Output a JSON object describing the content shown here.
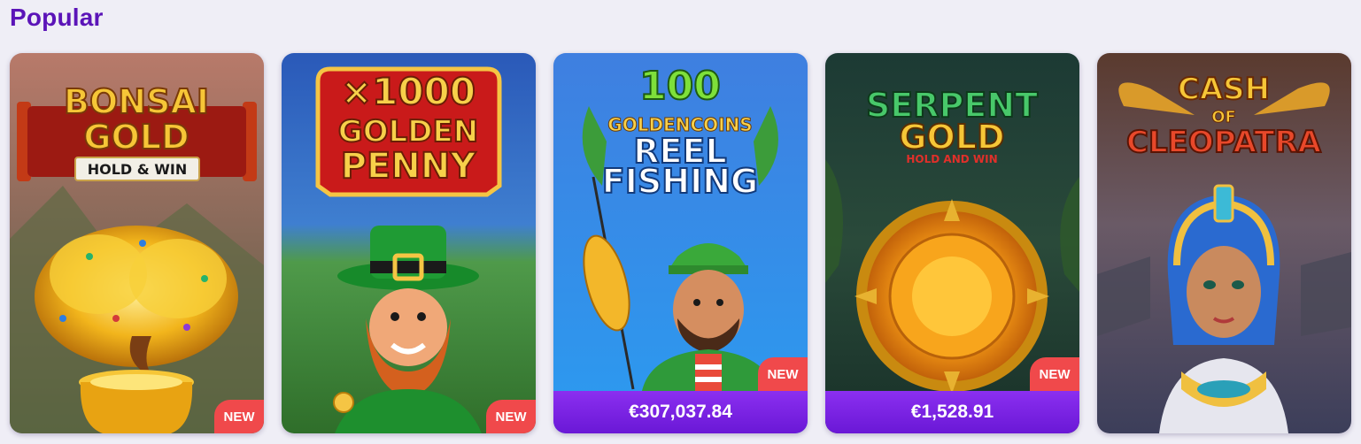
{
  "section": {
    "title": "Popular"
  },
  "games": [
    {
      "logo_lines": [
        "BONSAI",
        "GOLD",
        "HOLD & WIN"
      ],
      "badge": "NEW",
      "jackpot": null
    },
    {
      "logo_lines": [
        "×1000",
        "GOLDEN",
        "PENNY"
      ],
      "badge": "NEW",
      "jackpot": null
    },
    {
      "logo_lines": [
        "100",
        "GOLDENCOINS",
        "REEL",
        "FISHING"
      ],
      "badge": "NEW",
      "jackpot": "€307,037.84"
    },
    {
      "logo_lines": [
        "SERPENT",
        "GOLD",
        "HOLD AND WIN"
      ],
      "badge": "NEW",
      "jackpot": "€1,528.91"
    },
    {
      "logo_lines": [
        "CASH",
        "OF",
        "CLEOPATRA"
      ],
      "badge": null,
      "jackpot": null
    }
  ],
  "colors": {
    "title": "#5b14b8",
    "badge": "#f0494b",
    "jackpot_bar": "#7a22e6",
    "page_bg": "#efeef6"
  }
}
